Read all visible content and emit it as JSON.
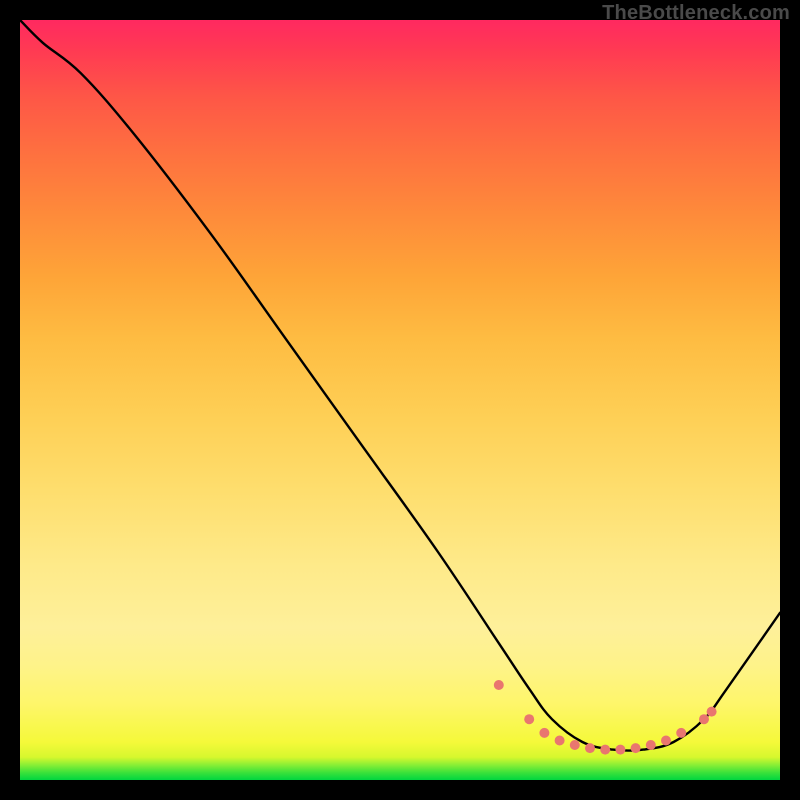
{
  "watermark": "TheBottleneck.com",
  "chart_data": {
    "type": "line",
    "title": "",
    "xlabel": "",
    "ylabel": "",
    "xlim": [
      0,
      100
    ],
    "ylim": [
      0,
      100
    ],
    "grid": false,
    "legend": false,
    "series": [
      {
        "name": "curve",
        "color": "#000000",
        "x": [
          0,
          3,
          8,
          15,
          25,
          35,
          45,
          55,
          63,
          67,
          70,
          74,
          78,
          82,
          86,
          90,
          93,
          100
        ],
        "y": [
          100,
          97,
          93,
          85,
          72,
          58,
          44,
          30,
          18,
          12,
          8,
          5,
          4,
          4,
          5,
          8,
          12,
          22
        ]
      }
    ],
    "markers": {
      "color": "#e9766f",
      "radius": 5,
      "points": [
        {
          "x": 63,
          "y": 12.5
        },
        {
          "x": 67,
          "y": 8.0
        },
        {
          "x": 69,
          "y": 6.2
        },
        {
          "x": 71,
          "y": 5.2
        },
        {
          "x": 73,
          "y": 4.6
        },
        {
          "x": 75,
          "y": 4.2
        },
        {
          "x": 77,
          "y": 4.0
        },
        {
          "x": 79,
          "y": 4.0
        },
        {
          "x": 81,
          "y": 4.2
        },
        {
          "x": 83,
          "y": 4.6
        },
        {
          "x": 85,
          "y": 5.2
        },
        {
          "x": 87,
          "y": 6.2
        },
        {
          "x": 90,
          "y": 8.0
        },
        {
          "x": 91,
          "y": 9.0
        }
      ]
    }
  }
}
